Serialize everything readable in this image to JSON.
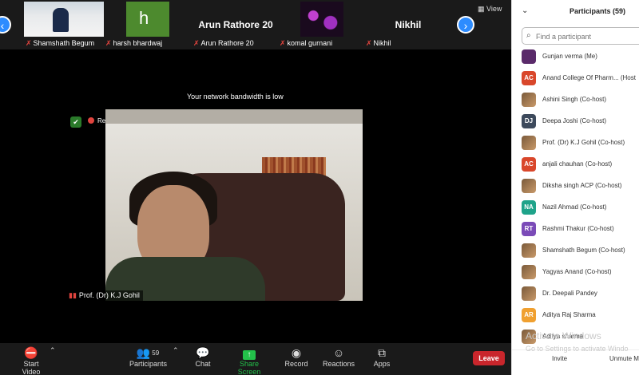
{
  "strip": {
    "tiles": [
      {
        "label": "Shamshath Begum"
      },
      {
        "letter": "h",
        "label": "harsh bhardwaj"
      },
      {
        "big": "Arun Rathore 20",
        "label": "Arun Rathore 20"
      },
      {
        "label": "komal gurnani"
      },
      {
        "big": "Nikhil",
        "label": "Nikhil"
      }
    ],
    "view_label": "View"
  },
  "stage": {
    "bandwidth_message": "Your network bandwidth is low",
    "recording_label": "Recording",
    "speaker_name": "Prof. (Dr) K.J Gohil"
  },
  "toolbar": {
    "start_video": "Start Video",
    "participants": "Participants",
    "participants_count": "59",
    "chat": "Chat",
    "share_screen": "Share Screen",
    "record": "Record",
    "reactions": "Reactions",
    "apps": "Apps",
    "leave": "Leave"
  },
  "panel": {
    "title": "Participants (59)",
    "search_placeholder": "Find a participant",
    "participants": [
      {
        "initials": "",
        "color": "#5a2a6a",
        "name": "Gunjan verma (Me)"
      },
      {
        "initials": "AC",
        "color": "#d9472b",
        "name": "Anand College Of Pharm... (Host"
      },
      {
        "initials": "",
        "color": "",
        "name": "Ashini Singh (Co-host)"
      },
      {
        "initials": "DJ",
        "color": "#3d4a5c",
        "name": "Deepa Joshi (Co-host)"
      },
      {
        "initials": "",
        "color": "",
        "name": "Prof. (Dr) K.J Gohil (Co-host)"
      },
      {
        "initials": "AC",
        "color": "#d9472b",
        "name": "anjali chauhan (Co-host)"
      },
      {
        "initials": "",
        "color": "",
        "name": "Diksha singh ACP (Co-host)"
      },
      {
        "initials": "NA",
        "color": "#1fa38a",
        "name": "Nazil Ahmad (Co-host)"
      },
      {
        "initials": "RT",
        "color": "#7b4bb8",
        "name": "Rashmi Thakur (Co-host)"
      },
      {
        "initials": "",
        "color": "",
        "name": "Shamshath Begum (Co-host)"
      },
      {
        "initials": "",
        "color": "",
        "name": "Yagyas Anand (Co-host)"
      },
      {
        "initials": "",
        "color": "",
        "name": "Dr. Deepali Pandey"
      },
      {
        "initials": "AR",
        "color": "#f0a030",
        "name": "Aditya Raj Sharma"
      },
      {
        "initials": "",
        "color": "",
        "name": "Aditya sharma"
      }
    ],
    "invite": "Invite",
    "mute_all": "Unmute M"
  },
  "watermark": {
    "line1": "Activate Windows",
    "line2": "Go to Settings to activate Windo"
  }
}
